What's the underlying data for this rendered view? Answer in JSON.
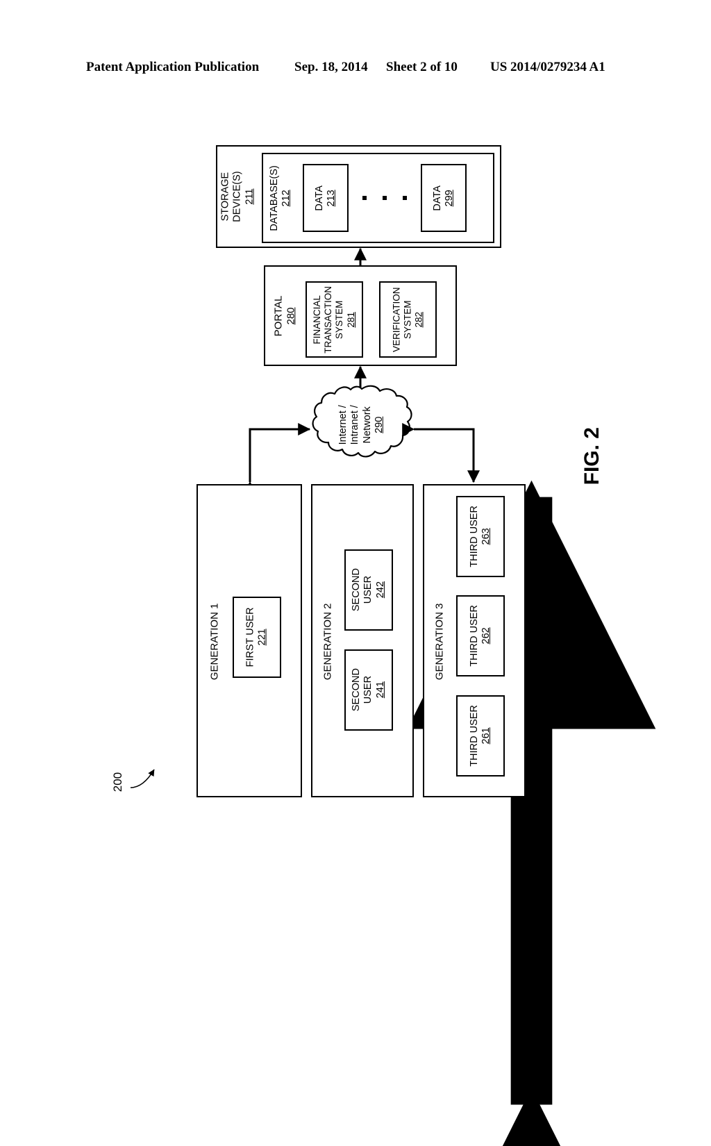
{
  "header": {
    "publication": "Patent Application Publication",
    "date": "Sep. 18, 2014",
    "sheet": "Sheet 2 of 10",
    "number": "US 2014/0279234 A1"
  },
  "figure": {
    "label": "FIG. 2",
    "system_ref": "200"
  },
  "storage": {
    "title": "STORAGE\nDEVICE(S)",
    "title_line1": "STORAGE",
    "title_line2": "DEVICE(S)",
    "ref": "211",
    "database": {
      "title": "DATABASE(S)",
      "ref": "212",
      "items": [
        {
          "label": "DATA",
          "ref": "213"
        },
        {
          "label": "DATA",
          "ref": "299"
        }
      ],
      "ellipsis": "• • •"
    }
  },
  "portal": {
    "title": "PORTAL",
    "ref": "280",
    "systems": [
      {
        "line1": "FINANCIAL",
        "line2": "TRANSACTION",
        "line3": "SYSTEM",
        "ref": "281"
      },
      {
        "line1": "VERIFICATION",
        "line2": "SYSTEM",
        "line3": "",
        "ref": "282"
      }
    ]
  },
  "network": {
    "line1": "Internet /",
    "line2": "Intranet /",
    "line3": "Network",
    "ref": "290"
  },
  "generations": [
    {
      "title": "GENERATION 1",
      "users": [
        {
          "line1": "FIRST USER",
          "line2": "",
          "ref": "221"
        }
      ]
    },
    {
      "title": "GENERATION 2",
      "users": [
        {
          "line1": "SECOND",
          "line2": "USER",
          "ref": "242"
        },
        {
          "line1": "SECOND",
          "line2": "USER",
          "ref": "241"
        }
      ]
    },
    {
      "title": "GENERATION 3",
      "users": [
        {
          "line1": "THIRD USER",
          "line2": "",
          "ref": "263"
        },
        {
          "line1": "THIRD USER",
          "line2": "",
          "ref": "262"
        },
        {
          "line1": "THIRD USER",
          "line2": "",
          "ref": "261"
        }
      ]
    }
  ],
  "colors": {
    "ink": "#000000",
    "paper": "#ffffff"
  }
}
